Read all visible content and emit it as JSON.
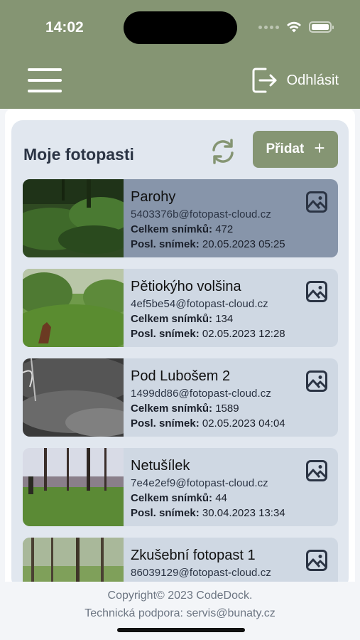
{
  "status_bar": {
    "time": "14:02"
  },
  "header": {
    "logout_label": "Odhlásit"
  },
  "panel": {
    "title": "Moje fotopasti",
    "add_label": "Přidat",
    "add_symbol": "+"
  },
  "labels": {
    "total": "Celkem snímků:",
    "last": "Posl. snímek:"
  },
  "cameras": [
    {
      "name": "Parohy",
      "email": "5403376b@fotopast-cloud.cz",
      "total": "472",
      "last": "20.05.2023 05:25",
      "thumb": "forest-night-green"
    },
    {
      "name": "Pětiokýho volšina",
      "email": "4ef5be54@fotopast-cloud.cz",
      "total": "134",
      "last": "02.05.2023 12:28",
      "thumb": "meadow-deer"
    },
    {
      "name": "Pod Lubošem 2",
      "email": "1499dd86@fotopast-cloud.cz",
      "total": "1589",
      "last": "02.05.2023 04:04",
      "thumb": "night-infrared"
    },
    {
      "name": "Netušílek",
      "email": "7e4e2ef9@fotopast-cloud.cz",
      "total": "44",
      "last": "30.04.2023 13:34",
      "thumb": "forest-hunter"
    },
    {
      "name": "Zkušební fotopast 1",
      "email": "86039129@fotopast-cloud.cz",
      "total": "",
      "last": "",
      "thumb": "forest-green"
    }
  ],
  "footer": {
    "copyright": "Copyright© 2023 CodeDock.",
    "support": "Technická podpora: servis@bunaty.cz"
  },
  "colors": {
    "header": "#859573",
    "panel": "#e1e7ef",
    "card": "#cfd8e3",
    "card_active": "#8795aa",
    "text_dark": "#2b3444"
  }
}
